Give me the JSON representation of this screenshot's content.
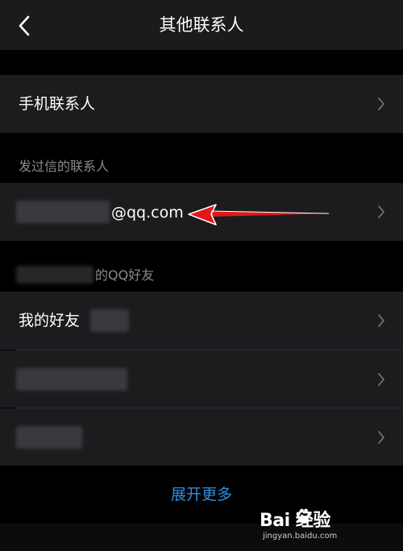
{
  "header": {
    "title": "其他联系人",
    "back_icon": "chevron-left-icon"
  },
  "phone_contacts": {
    "label": "手机联系人"
  },
  "mailed_section": {
    "label": "发过信的联系人"
  },
  "mailed_contact": {
    "email_suffix": "@qq.com"
  },
  "qq_section": {
    "label_suffix": "的QQ好友"
  },
  "my_friends": {
    "label": "我的好友"
  },
  "expand": {
    "label": "展开更多"
  },
  "watermark": {
    "brand": "Bai 经验",
    "domain": "jingyan.baidu.com"
  },
  "colors": {
    "background": "#000000",
    "row_background": "#1c1c1f",
    "accent_blue": "#2f8fe0",
    "annotation_arrow": "#e01818"
  }
}
